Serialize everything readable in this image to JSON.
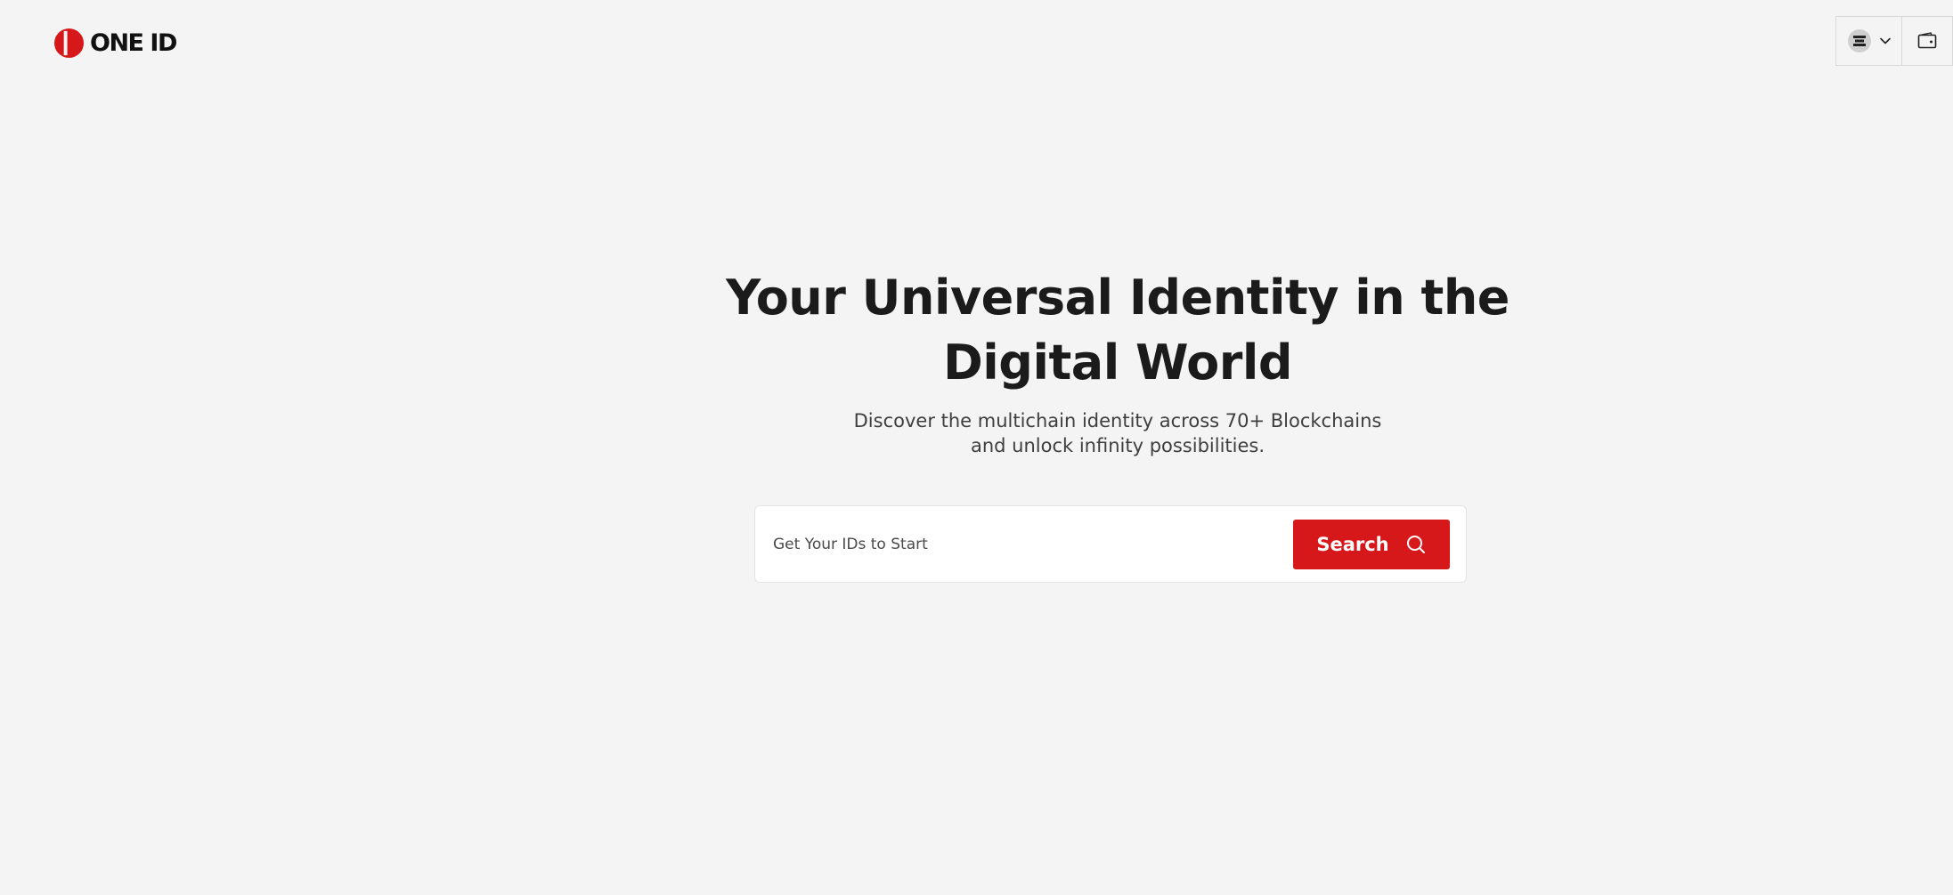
{
  "header": {
    "logo_text": "ONE ID",
    "brand_color": "#d7181b",
    "chain_selector_icon": "chain-logo-icon",
    "chain_selector_caret": "chevron-down-icon",
    "wallet_icon": "wallet-icon"
  },
  "hero": {
    "title": "Your Universal Identity in the Digital World",
    "subtitle_line1": "Discover the multichain identity across 70+ Blockchains",
    "subtitle_line2": "and unlock infinity possibilities."
  },
  "search": {
    "placeholder": "Get Your IDs to Start",
    "value": "",
    "button_label": "Search",
    "button_icon": "search-icon",
    "button_color": "#d7181b"
  }
}
